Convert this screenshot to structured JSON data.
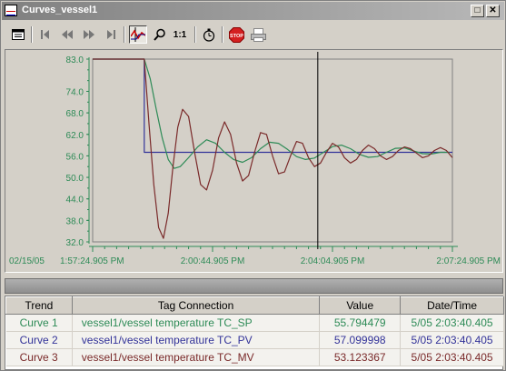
{
  "window": {
    "title": "Curves_vessel1"
  },
  "titlebar_buttons": {
    "maximize": "□",
    "close": "✕"
  },
  "toolbar": {
    "tools": [
      "properties-icon",
      "first-icon",
      "rewind-icon",
      "forward-icon",
      "last-icon",
      "cursor-icon",
      "zoom-icon",
      "zoom-reset-icon",
      "timer-icon",
      "stop-icon",
      "print-icon"
    ],
    "zoom_reset_label": "1:1",
    "stop_label": "STOP"
  },
  "chart_data": {
    "type": "line",
    "ylim": [
      32.0,
      83.0
    ],
    "yticks": [
      "83.0",
      "74.0",
      "68.0",
      "62.0",
      "56.0",
      "50.0",
      "44.0",
      "38.0",
      "32.0"
    ],
    "ytick_values": [
      83.0,
      74.0,
      68.0,
      62.0,
      56.0,
      50.0,
      44.0,
      38.0,
      32.0
    ],
    "x_date_label": "02/15/05",
    "xticks": [
      "1:57:24.905 PM",
      "2:00:44.905 PM",
      "2:04:04.905 PM",
      "2:07:24.905 PM"
    ],
    "xtick_seconds": [
      0,
      200,
      400,
      600
    ],
    "xlim_seconds": [
      0,
      600
    ],
    "cursor_seconds": 375.5,
    "grid": false,
    "series": [
      {
        "name": "Curve 1",
        "color": "#333399",
        "x": [
          0,
          86,
          86,
          600
        ],
        "values": [
          83.0,
          83.0,
          57.0,
          57.0
        ]
      },
      {
        "name": "Curve 2",
        "color": "#2e8b57",
        "x": [
          0,
          86,
          96,
          106,
          116,
          126,
          136,
          146,
          160,
          175,
          190,
          205,
          220,
          235,
          250,
          265,
          280,
          295,
          310,
          325,
          340,
          355,
          370,
          385,
          400,
          415,
          430,
          445,
          460,
          475,
          490,
          505,
          520,
          535,
          550,
          565,
          580,
          595
        ],
        "values": [
          83.0,
          83.0,
          77.5,
          69.0,
          61.0,
          55.0,
          52.5,
          53.0,
          55.5,
          58.5,
          60.5,
          59.5,
          57.0,
          55.0,
          54.2,
          55.5,
          58.0,
          59.8,
          59.5,
          57.8,
          55.8,
          55.0,
          55.4,
          57.0,
          58.6,
          59.0,
          58.0,
          56.4,
          55.6,
          55.8,
          57.0,
          58.1,
          58.2,
          57.4,
          56.6,
          56.5,
          57.0,
          57.0
        ]
      },
      {
        "name": "Curve 3",
        "color": "#7a2a2a",
        "x": [
          0,
          86,
          94,
          102,
          110,
          118,
          126,
          134,
          142,
          150,
          160,
          170,
          180,
          190,
          200,
          210,
          220,
          230,
          240,
          250,
          260,
          270,
          280,
          290,
          300,
          310,
          320,
          330,
          340,
          350,
          360,
          370,
          380,
          390,
          400,
          410,
          420,
          430,
          440,
          450,
          460,
          470,
          480,
          490,
          500,
          510,
          520,
          530,
          540,
          550,
          560,
          570,
          580,
          590,
          600
        ],
        "values": [
          83.0,
          83.0,
          65.0,
          48.0,
          36.0,
          33.0,
          40.0,
          53.0,
          64.0,
          69.0,
          67.0,
          57.0,
          48.0,
          46.5,
          52.0,
          61.0,
          65.5,
          62.0,
          54.0,
          49.0,
          50.5,
          57.0,
          62.5,
          62.0,
          56.0,
          51.0,
          51.5,
          56.0,
          60.0,
          59.5,
          55.5,
          53.0,
          54.0,
          57.0,
          59.5,
          58.5,
          55.5,
          54.0,
          55.0,
          57.5,
          59.0,
          58.0,
          56.0,
          55.0,
          55.8,
          57.5,
          58.5,
          58.0,
          56.8,
          55.5,
          56.0,
          57.5,
          58.3,
          57.5,
          55.5
        ]
      }
    ]
  },
  "table": {
    "headers": {
      "trend": "Trend",
      "tag": "Tag Connection",
      "value": "Value",
      "datetime": "Date/Time"
    },
    "rows": [
      {
        "trend": "Curve 1",
        "tag": "vessel1/vessel temperature TC_SP",
        "value": "55.794479",
        "datetime": "5/05 2:03:40.405",
        "color": "#2e8b57"
      },
      {
        "trend": "Curve 2",
        "tag": "vessel1/vessel temperature TC_PV",
        "value": "57.099998",
        "datetime": "5/05 2:03:40.405",
        "color": "#333399"
      },
      {
        "trend": "Curve 3",
        "tag": "vessel1/vessel temperature TC_MV",
        "value": "53.123367",
        "datetime": "5/05 2:03:40.405",
        "color": "#7a2a2a"
      }
    ]
  }
}
